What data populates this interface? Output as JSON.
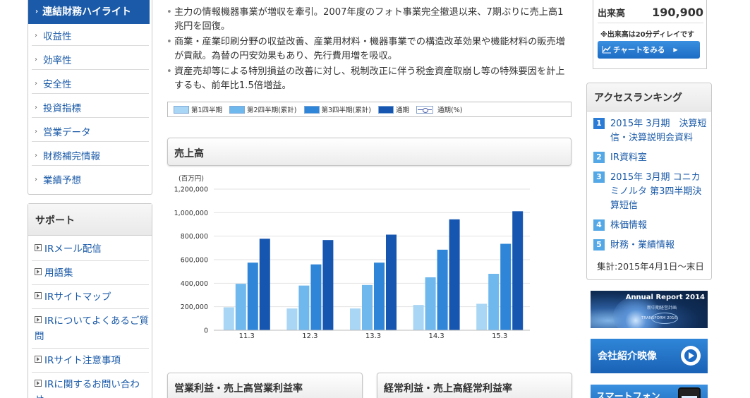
{
  "sidebar": {
    "active": "連結財務ハイライト",
    "items": [
      "収益性",
      "効率性",
      "安全性",
      "投資指標",
      "営業データ",
      "財務補完情報",
      "業績予想"
    ]
  },
  "support": {
    "title": "サポート",
    "items": [
      "IRメール配信",
      "用語集",
      "IRサイトマップ",
      "IRについてよくあるご質問",
      "IRサイト注意事項",
      "IRに関するお問い合わせ"
    ]
  },
  "bullets": [
    "主力の情報機器事業が増収を牽引。2007年度のフォト事業完全撤退以来、7期ぶりに売上高1兆円を回復。",
    "商業・産業印刷分野の収益改善、産業用材料・機器事業での構造改革効果や機能材料の販売増が貢献。為替の円安効果もあり、先行費用増を吸収。",
    "資産売却等による特別損益の改善に対し、税制改正に伴う税金資産取崩し等の特殊要因を計上するも、前年比1.5倍増益。"
  ],
  "legend": {
    "q1": "第1四半期",
    "q2": "第2四半期(累計)",
    "q3": "第3四半期(累計)",
    "full": "通期",
    "pct": "通期(%)"
  },
  "panels": {
    "sales": "売上高",
    "op_income": "営業利益・売上高営業利益率",
    "ord_income": "経常利益・売上高経常利益率"
  },
  "stock": {
    "label": "出来高",
    "value": "190,900",
    "note": "※出来高は20分ディレイです",
    "button": "チャートをみる"
  },
  "ranking": {
    "title": "アクセスランキング",
    "items": [
      {
        "num": "1",
        "text": "2015年 3月期　決算短信・決算説明会資料"
      },
      {
        "num": "2",
        "text": "IR資料室"
      },
      {
        "num": "3",
        "text": "2015年 3月期 コニカミノルタ 第3四半期決算短信"
      },
      {
        "num": "4",
        "text": "株価情報"
      },
      {
        "num": "5",
        "text": "財務・業績情報"
      }
    ],
    "footer": "集計:2015年4月1日～末日"
  },
  "banners": {
    "annual_title": "Annual Report 2014",
    "annual_sub": "新中期経営計画",
    "annual_logo": "TRANSFORM 2016",
    "video": "会社紹介映像",
    "phone": "スマートフォン"
  },
  "colors": {
    "q1": "#a9d6f5",
    "q2": "#6fb8ee",
    "q3": "#2f86d8",
    "full": "#1656b0",
    "nav_active": "#1a5aa8",
    "link": "#1a5aa8"
  },
  "chart_data": {
    "type": "bar",
    "ylabel": "(百万円)",
    "ylim": [
      0,
      1200000
    ],
    "yticks": [
      "1,200,000",
      "1,000,000",
      "800,000",
      "600,000",
      "400,000",
      "200,000",
      "0"
    ],
    "grid": true,
    "categories": [
      "11.3",
      "12.3",
      "13.3",
      "14.3",
      "15.3"
    ],
    "series": [
      {
        "name": "第1四半期",
        "values": [
          195000,
          185000,
          185000,
          215000,
          225000
        ]
      },
      {
        "name": "第2四半期(累計)",
        "values": [
          395000,
          380000,
          385000,
          450000,
          480000
        ]
      },
      {
        "name": "第3四半期(累計)",
        "values": [
          575000,
          560000,
          575000,
          685000,
          735000
        ]
      },
      {
        "name": "通期",
        "values": [
          778000,
          767000,
          813000,
          943000,
          1012000
        ]
      }
    ]
  }
}
